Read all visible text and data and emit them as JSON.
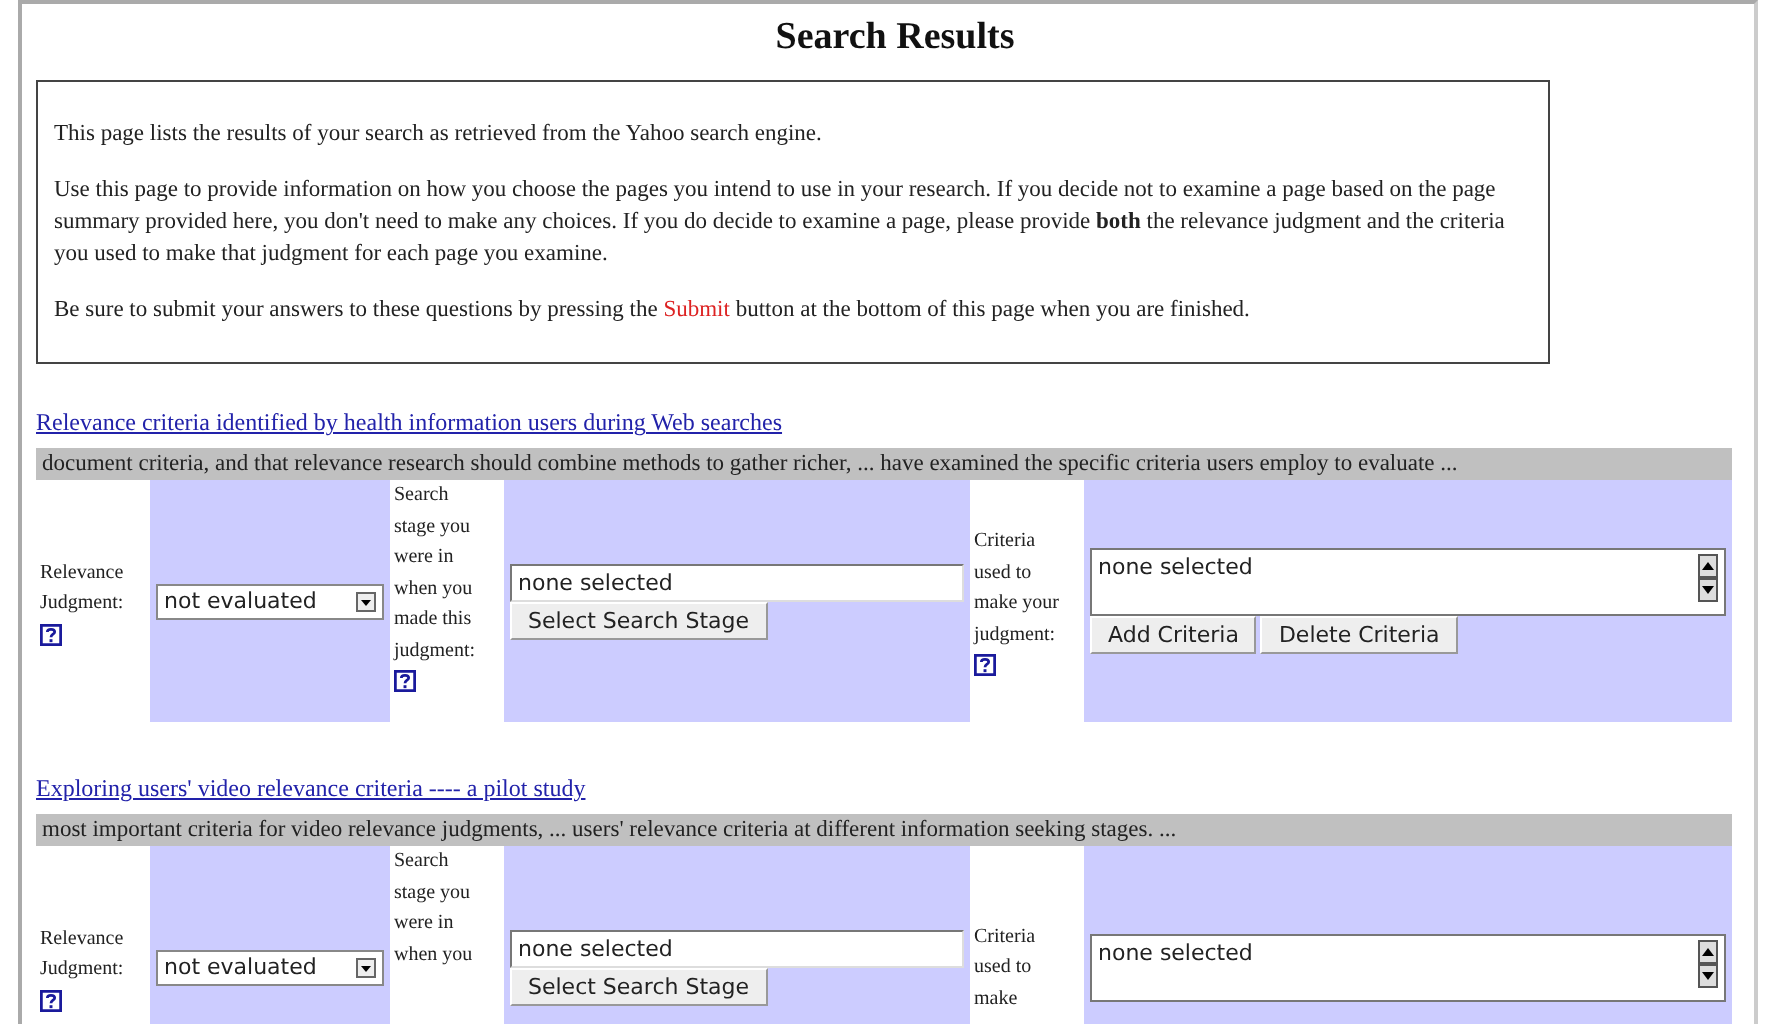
{
  "title": "Search Results",
  "instructions": [
    {
      "text": "This page lists the results of your search as retrieved from the Yahoo search engine."
    },
    {
      "text": "Use this page to provide information on how you choose the pages you intend to use in your research. If you decide not to examine a page based on the page summary provided here, you don't need to make any choices. If you do decide to examine a page, please provide **both** the relevance judgment and the criteria you used to make that judgment for each page you examine."
    },
    {
      "text": "Be sure to submit your answers to these questions by pressing the",
      "highlight": "Submit",
      "after": "button at the bottom of this page when you are finished."
    }
  ],
  "results": [
    {
      "title": "Relevance criteria identified by health information users during Web searches",
      "snippet": "document criteria, and that relevance research should combine methods to gather richer, ... have examined the specific criteria users employ to evaluate ...",
      "judgment_label": "Relevance Judgment:",
      "judgment_value": "not evaluated",
      "stage_label": "Search stage you were in when you made this judgment:",
      "stage_help": true,
      "stage_value": "none selected",
      "stage_button": "Select Search Stage",
      "criteria_label": "Criteria used to make your judgment:",
      "criteria_help": true,
      "criteria_value": "none selected",
      "criteria_buttons": [
        "Add Criteria",
        "Delete Criteria"
      ]
    },
    {
      "title": "Exploring users' video relevance criteria ---- a pilot study",
      "snippet": "most important criteria for video relevance judgments, ... users' relevance criteria at different information seeking stages. ...",
      "judgment_label": "Relevance Judgment:",
      "judgment_value": "not evaluated",
      "stage_label": "Search stage you were in when you",
      "stage_value": "none selected",
      "stage_button": "Select Search Stage",
      "criteria_label": "Criteria used to make",
      "criteria_value": "none selected"
    }
  ]
}
